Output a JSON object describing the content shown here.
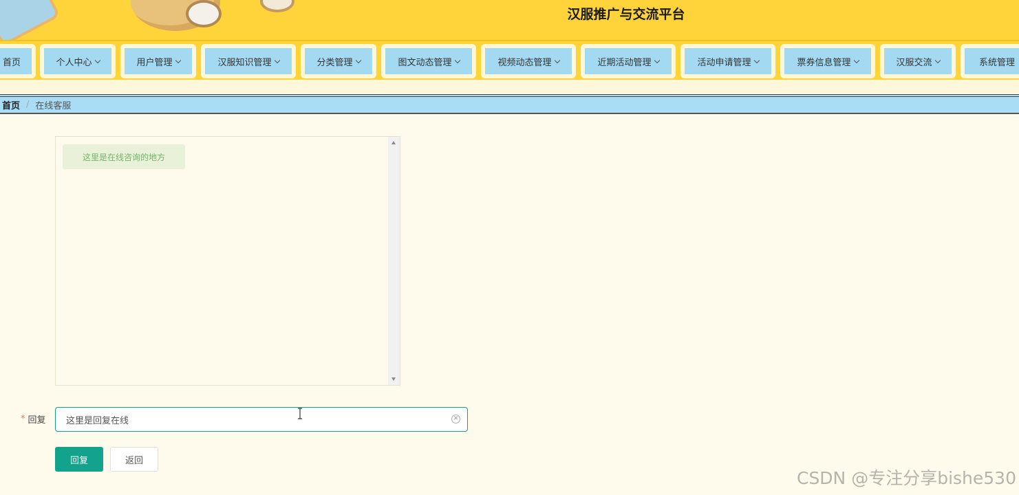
{
  "header": {
    "title": "汉服推广与交流平台"
  },
  "nav": {
    "items": [
      {
        "label": "首页",
        "has_dropdown": false
      },
      {
        "label": "个人中心",
        "has_dropdown": true
      },
      {
        "label": "用户管理",
        "has_dropdown": true
      },
      {
        "label": "汉服知识管理",
        "has_dropdown": true
      },
      {
        "label": "分类管理",
        "has_dropdown": true
      },
      {
        "label": "图文动态管理",
        "has_dropdown": true
      },
      {
        "label": "视频动态管理",
        "has_dropdown": true
      },
      {
        "label": "近期活动管理",
        "has_dropdown": true
      },
      {
        "label": "活动申请管理",
        "has_dropdown": true
      },
      {
        "label": "票券信息管理",
        "has_dropdown": true
      },
      {
        "label": "汉服交流",
        "has_dropdown": true
      },
      {
        "label": "系统管理",
        "has_dropdown": false
      }
    ]
  },
  "breadcrumb": {
    "home": "首页",
    "separator": "/",
    "current": "在线客服"
  },
  "chat": {
    "messages": [
      {
        "text": "这里是在线咨询的地方"
      }
    ]
  },
  "reply": {
    "label": "回复",
    "required_mark": "*",
    "value": "这里是回复在线"
  },
  "buttons": {
    "submit": "回复",
    "back": "返回"
  },
  "watermark": "CSDN @专注分享bishe530",
  "colors": {
    "header_bg": "#ffd43b",
    "nav_item_bg": "#a4d9f2",
    "primary": "#13a38c",
    "page_bg": "#fffbec"
  }
}
